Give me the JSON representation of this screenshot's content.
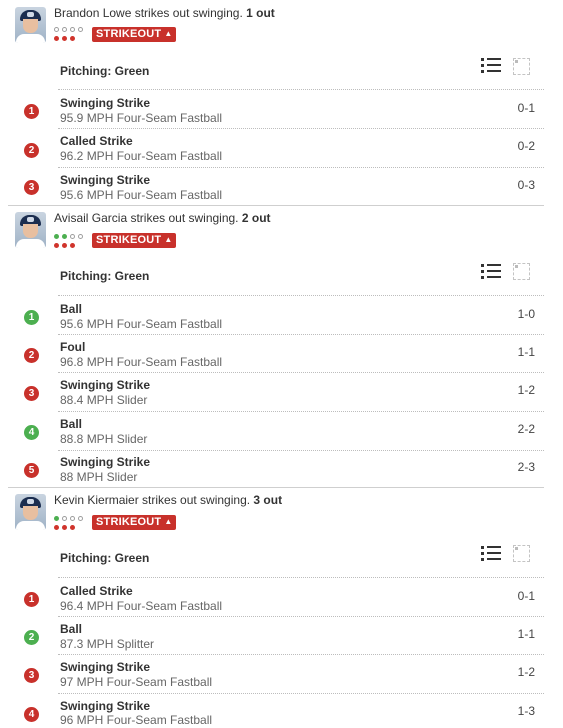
{
  "at_bats": [
    {
      "headline": "Brandon Lowe strikes out swinging.",
      "outs": "1 out",
      "badge": "STRIKEOUT",
      "caret": "▲",
      "pitcher_label": "Pitching: Green",
      "pitches": [
        {
          "num": "1",
          "result": "Swinging Strike",
          "detail": "95.9 MPH Four-Seam Fastball",
          "count": "0-1",
          "color": "red"
        },
        {
          "num": "2",
          "result": "Called Strike",
          "detail": "96.2 MPH Four-Seam Fastball",
          "count": "0-2",
          "color": "red"
        },
        {
          "num": "3",
          "result": "Swinging Strike",
          "detail": "95.6 MPH Four-Seam Fastball",
          "count": "0-3",
          "color": "red"
        }
      ]
    },
    {
      "headline": "Avisail Garcia strikes out swinging.",
      "outs": "2 out",
      "badge": "STRIKEOUT",
      "caret": "▲",
      "pitcher_label": "Pitching: Green",
      "pitches": [
        {
          "num": "1",
          "result": "Ball",
          "detail": "95.6 MPH Four-Seam Fastball",
          "count": "1-0",
          "color": "green"
        },
        {
          "num": "2",
          "result": "Foul",
          "detail": "96.8 MPH Four-Seam Fastball",
          "count": "1-1",
          "color": "red"
        },
        {
          "num": "3",
          "result": "Swinging Strike",
          "detail": "88.4 MPH Slider",
          "count": "1-2",
          "color": "red"
        },
        {
          "num": "4",
          "result": "Ball",
          "detail": "88.8 MPH Slider",
          "count": "2-2",
          "color": "green"
        },
        {
          "num": "5",
          "result": "Swinging Strike",
          "detail": "88 MPH Slider",
          "count": "2-3",
          "color": "red"
        }
      ]
    },
    {
      "headline": "Kevin Kiermaier strikes out swinging.",
      "outs": "3 out",
      "badge": "STRIKEOUT",
      "caret": "▲",
      "pitcher_label": "Pitching: Green",
      "pitches": [
        {
          "num": "1",
          "result": "Called Strike",
          "detail": "96.4 MPH Four-Seam Fastball",
          "count": "0-1",
          "color": "red"
        },
        {
          "num": "2",
          "result": "Ball",
          "detail": "87.3 MPH Splitter",
          "count": "1-1",
          "color": "green"
        },
        {
          "num": "3",
          "result": "Swinging Strike",
          "detail": "97 MPH Four-Seam Fastball",
          "count": "1-2",
          "color": "red"
        },
        {
          "num": "4",
          "result": "Swinging Strike",
          "detail": "96 MPH Four-Seam Fastball",
          "count": "1-3",
          "color": "red"
        }
      ]
    }
  ],
  "colors": {
    "red": "#c8312b",
    "green": "#4caf50"
  },
  "icons": {
    "list": "list-view-icon",
    "zone": "strike-zone-icon"
  }
}
